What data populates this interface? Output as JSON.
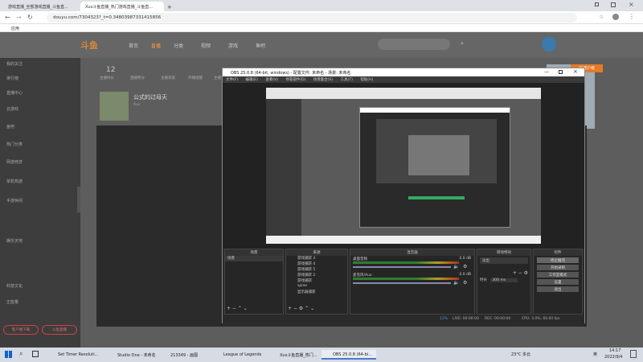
{
  "browser": {
    "tabs": [
      {
        "label": "游戏直播_全部游戏直播_斗鱼直..."
      },
      {
        "label": "Xus斗鱼直播_热门游戏直播_斗鱼直..."
      },
      {
        "label": "+"
      }
    ],
    "url": "douyu.com/7304323?_t=0.34803987331415856",
    "bookmark": "应用"
  },
  "douyu": {
    "logo": "斗鱼",
    "nav": [
      "首页",
      "直播",
      "分类",
      "视频",
      "游戏",
      "鱼吧"
    ],
    "header_stats": [
      {
        "num": "12",
        "label": "主播时长"
      },
      {
        "label": "直播积分"
      },
      {
        "label": "主播荣誉"
      },
      {
        "label": "开播提醒"
      },
      {
        "label": "主播认证"
      }
    ],
    "streamer_name": "公式的过母天",
    "streamer_sub": "Xus",
    "sidebar": [
      {
        "label": "我的关注"
      },
      {
        "label": "排行榜"
      },
      {
        "label": "直播中心"
      },
      {
        "label": "云游戏"
      },
      {
        "label": "鱼吧"
      },
      {
        "label": "热门分类"
      },
      {
        "label": "网游竞技"
      },
      {
        "label": "单机热游"
      },
      {
        "label": "手游休闲"
      },
      {
        "label": "娱乐天地"
      },
      {
        "label": "科技文化"
      },
      {
        "label": "正能量"
      }
    ],
    "sidebar_buttons": [
      "客户端下载",
      "斗鱼直播"
    ],
    "right_badge": "PC客户端"
  },
  "obs": {
    "title": "OBS 25.0.8 (64-bit, windows) - 配置文件: 未命名 - 场景: 未命名",
    "menu": [
      "文件(F)",
      "编辑(E)",
      "查看(V)",
      "停靠部件(D)",
      "场景集合(S)",
      "工具(T)",
      "帮助(H)"
    ],
    "docks": {
      "scenes": {
        "title": "场景",
        "items": [
          "场景"
        ]
      },
      "sources": {
        "title": "来源",
        "items": [
          "游戏捕获 3",
          "游戏捕获 4",
          "游戏捕获 5",
          "游戏捕获 2",
          "游戏捕获",
          "spine",
          "显示器捕获"
        ]
      },
      "mixer": {
        "title": "混音器",
        "channels": [
          {
            "name": "桌面音频",
            "db": "0.0 dB"
          },
          {
            "name": "麦克风/Aux",
            "db": "0.0 dB"
          }
        ]
      },
      "transitions": {
        "title": "转场特效",
        "type": "淡出",
        "duration_label": "时长",
        "duration": "300 ms"
      },
      "controls": {
        "title": "控件",
        "buttons": [
          "停止推流",
          "开始录制",
          "工作室模式",
          "设置",
          "退出"
        ]
      }
    },
    "status": {
      "live": "LIVE: 00:00:00",
      "rec": "REC: 00:00:00",
      "cpu": "CPU: 3.0%, 60.00 fps",
      "dropped": "12%"
    }
  },
  "taskbar": {
    "items": [
      {
        "label": "Set Timer Resoluti..."
      },
      {
        "label": "Studio One - 未命名"
      },
      {
        "label": "213349 - 画图"
      },
      {
        "label": "League of Legends"
      },
      {
        "label": "Xus斗鱼直播_热门..."
      },
      {
        "label": "OBS 25.0.8 (64-bi..."
      }
    ],
    "weather": "23°C 多云",
    "lang": "英",
    "time": "14:17",
    "date": "2022/9/4"
  },
  "colors": {
    "accent": "#ff7a00",
    "obs_bg": "#2f2f2f",
    "taskbar": "#d7dbe3"
  }
}
